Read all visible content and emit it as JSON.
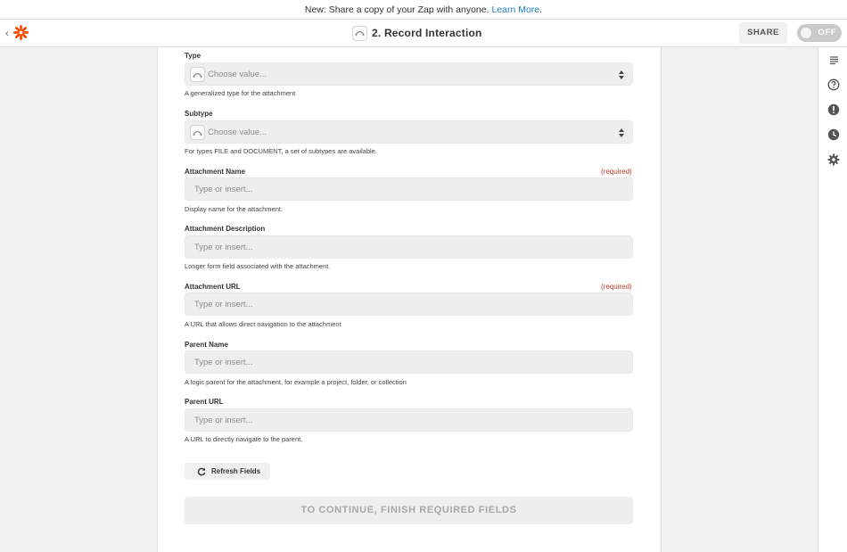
{
  "banner": {
    "prefix": "New: Share a copy of your Zap with anyone. ",
    "link": "Learn More",
    "suffix": "."
  },
  "header": {
    "step_title": "2. Record Interaction",
    "share_label": "SHARE",
    "toggle_label": "OFF"
  },
  "fields": [
    {
      "label": "Type",
      "type": "select",
      "placeholder": "Choose value...",
      "help": "A generalized type for the attachment",
      "required": false
    },
    {
      "label": "Subtype",
      "type": "select",
      "placeholder": "Choose value...",
      "help": "For types FILE and DOCUMENT, a set of subtypes are available.",
      "required": false
    },
    {
      "label": "Attachment Name",
      "type": "text",
      "placeholder": "Type or insert...",
      "help": "Display name for the attachment.",
      "required": true
    },
    {
      "label": "Attachment Description",
      "type": "text",
      "placeholder": "Type or insert...",
      "help": "Longer form field associated with the attachment.",
      "required": false
    },
    {
      "label": "Attachment URL",
      "type": "text",
      "placeholder": "Type or insert...",
      "help": "A URL that allows direct navigation to the attachment",
      "required": true
    },
    {
      "label": "Parent Name",
      "type": "text",
      "placeholder": "Type or insert...",
      "help": "A logic parent for the attachment, for example a project, folder, or collection",
      "required": false
    },
    {
      "label": "Parent URL",
      "type": "text",
      "placeholder": "Type or insert...",
      "help": "A URL to directly navigate to the parent.",
      "required": false
    }
  ],
  "required_label": "(required)",
  "refresh_label": "Refresh Fields",
  "continue_label": "TO CONTINUE, FINISH REQUIRED FIELDS",
  "colors": {
    "brand": "#ff4a00",
    "link": "#1e7fbf",
    "required": "#c0392b"
  },
  "rail_icons": [
    "notes-icon",
    "help-icon",
    "alert-icon",
    "history-icon",
    "settings-icon"
  ]
}
